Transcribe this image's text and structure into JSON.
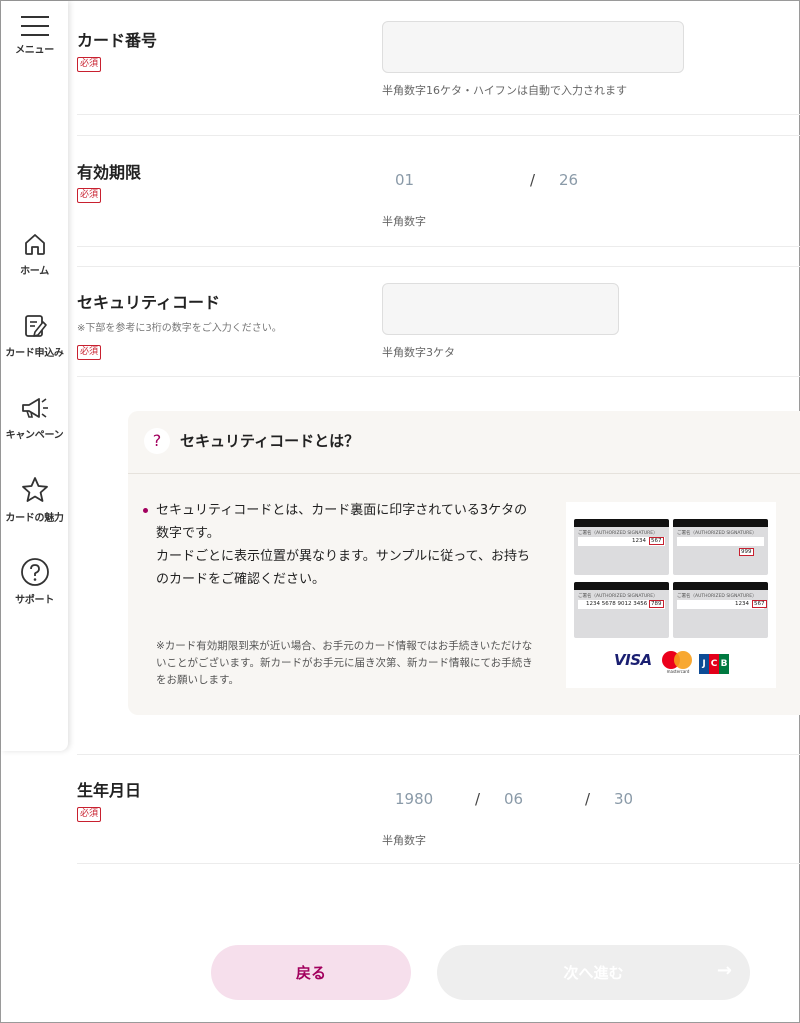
{
  "sidebar": {
    "menu_label": "メニュー",
    "items": [
      {
        "label": "ホーム",
        "icon": "home-icon"
      },
      {
        "label": "カード申込み",
        "icon": "application-icon"
      },
      {
        "label": "キャンペーン",
        "icon": "megaphone-icon"
      },
      {
        "label": "カードの魅力",
        "icon": "star-icon"
      },
      {
        "label": "サポート",
        "icon": "help-icon"
      }
    ]
  },
  "form": {
    "required_label": "必須",
    "card_number": {
      "title": "カード番号",
      "value": "",
      "hint": "半角数字16ケタ・ハイフンは自動で入力されます"
    },
    "expiry": {
      "title": "有効期限",
      "month": "01",
      "separator": "/",
      "year": "26",
      "hint": "半角数字"
    },
    "security_code": {
      "title": "セキュリティコード",
      "note": "※下部を参考に3桁の数字をご入力ください。",
      "value": "",
      "hint": "半角数字3ケタ"
    },
    "birthday": {
      "title": "生年月日",
      "year": "1980",
      "month": "06",
      "day": "30",
      "separator": "/",
      "hint": "半角数字"
    }
  },
  "info": {
    "icon": "?",
    "title": "セキュリティコードとは？",
    "body": "セキュリティコードとは、カード裏面に印字されている3ケタの数字です。\nカードごとに表示位置が異なります。サンプルに従って、お持ちのカードをご確認ください。",
    "note": "※カード有効期限到来が近い場合、お手元のカード情報ではお手続きいただけないことがございます。新カードがお手元に届き次第、新カード情報にてお手続きをお願いします。",
    "sample_cards": [
      {
        "label": "ご署名（AUTHORIZED SIGNATURE）",
        "number": "1234",
        "code": "567"
      },
      {
        "label": "ご署名（AUTHORIZED SIGNATURE）",
        "number": "",
        "code": "999"
      },
      {
        "label": "ご署名（AUTHORIZED SIGNATURE）",
        "number": "1234 5678 9012 3456",
        "code": "789"
      },
      {
        "label": "ご署名（AUTHORIZED SIGNATURE）",
        "number": "1234",
        "code": "567"
      }
    ],
    "brands": {
      "visa": "VISA",
      "mastercard": "mastercard",
      "jcb": [
        "J",
        "C",
        "B"
      ]
    }
  },
  "buttons": {
    "back": "戻る",
    "next": "次へ進む",
    "next_arrow": "→"
  },
  "colors": {
    "accent": "#a2005e",
    "required": "#c8202f",
    "back_bg": "#f6dfec",
    "next_disabled_bg": "#eeeeee"
  }
}
